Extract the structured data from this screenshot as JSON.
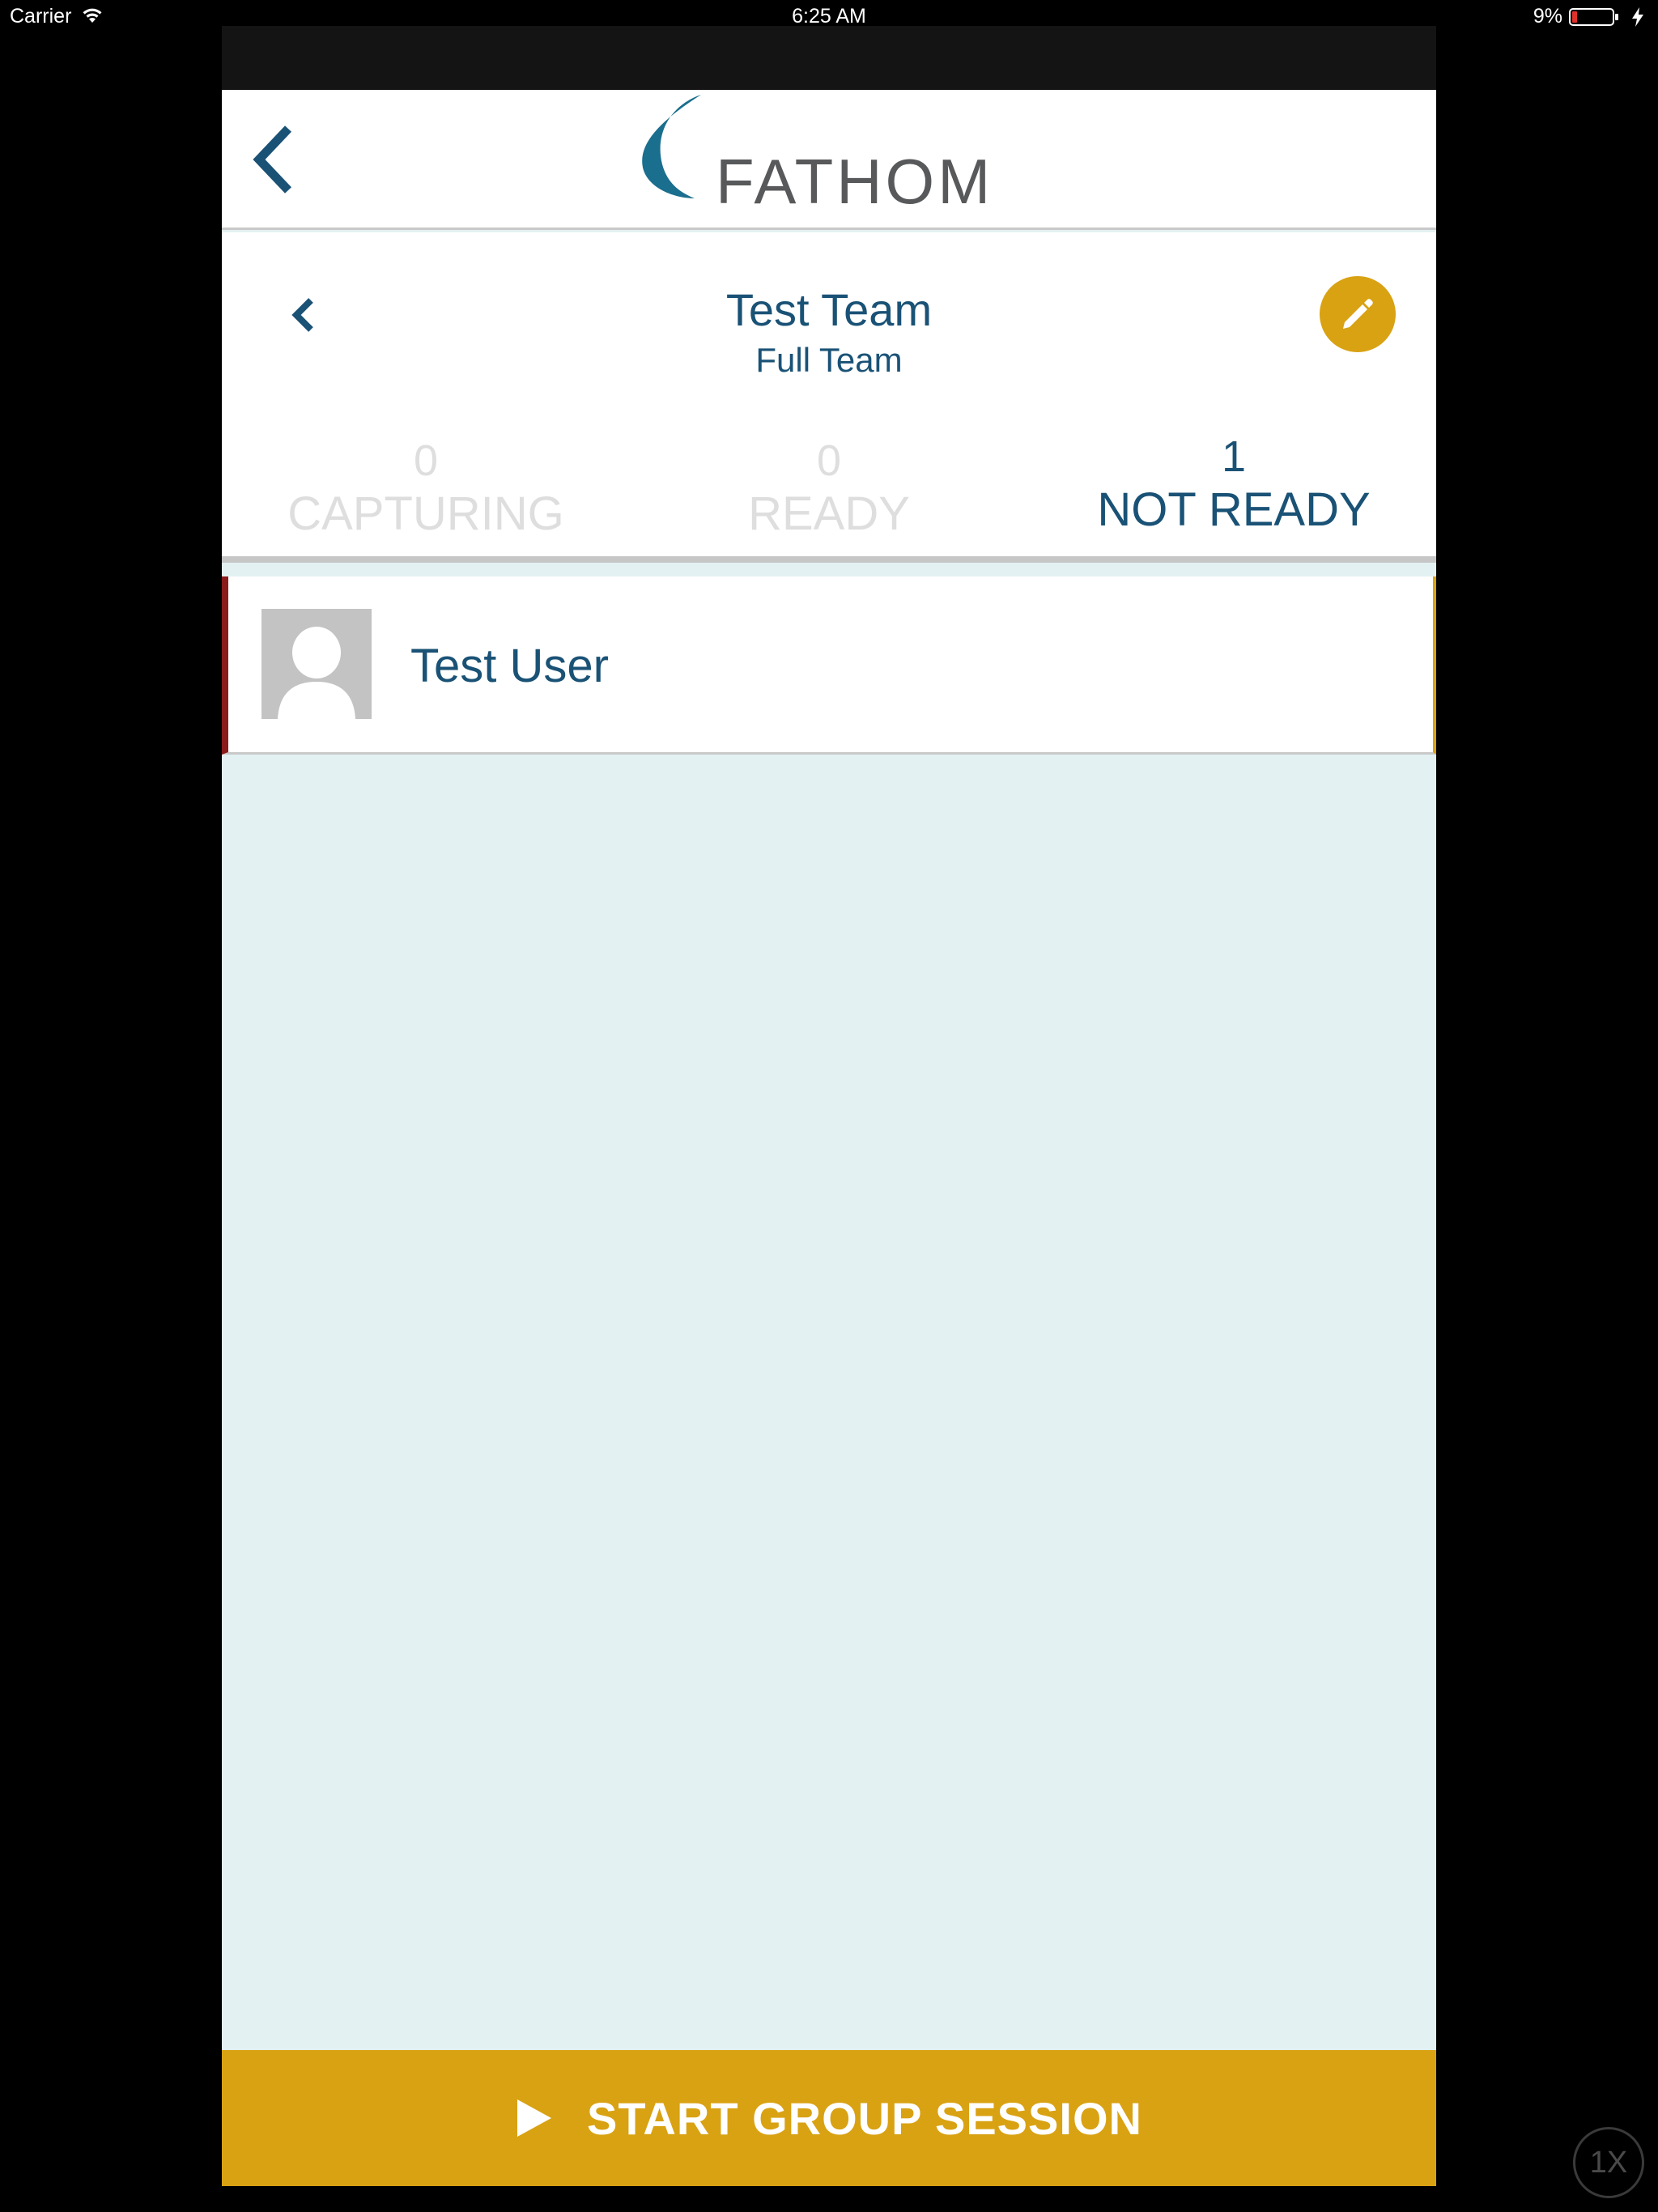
{
  "status_bar": {
    "carrier": "Carrier",
    "time": "6:25 AM",
    "battery": "9%"
  },
  "header": {
    "logo_text": "FATHOM",
    "back_icon": "chevron-left-icon"
  },
  "team": {
    "title": "Test Team",
    "subtitle": "Full Team",
    "prev_icon": "chevron-left-icon",
    "edit_icon": "pencil-icon"
  },
  "stats": [
    {
      "count": "0",
      "label": "CAPTURING",
      "active": false
    },
    {
      "count": "0",
      "label": "READY",
      "active": false
    },
    {
      "count": "1",
      "label": "NOT READY",
      "active": true
    }
  ],
  "users": [
    {
      "name": "Test User",
      "avatar_icon": "person-placeholder-icon"
    }
  ],
  "actions": {
    "start_label": "START GROUP SESSION",
    "start_icon": "play-icon"
  },
  "zoom_indicator": "1X",
  "colors": {
    "primary_text": "#1a5276",
    "accent_gold": "#d9a213",
    "list_background": "#e3f1f2",
    "not_ready_marker": "#8b1a1a",
    "dim_text": "#dedede",
    "logo_teal": "#1a6e8e"
  }
}
